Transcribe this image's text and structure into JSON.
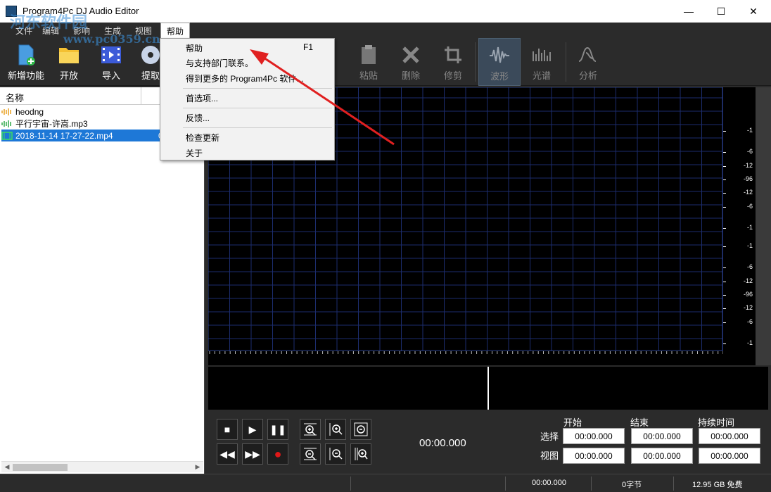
{
  "window": {
    "title": "Program4Pc DJ Audio Editor",
    "watermark": "河东软件园",
    "watermark_url": "www.pc0359.cn",
    "minimize": "—",
    "maximize": "☐",
    "close": "✕"
  },
  "menubar": {
    "items": [
      "文件",
      "编辑",
      "影响",
      "生成",
      "视图",
      "帮助"
    ],
    "active": "帮助"
  },
  "toolbar": {
    "new": "新增功能",
    "open": "开放",
    "import": "导入",
    "extract": "提取",
    "paste": "粘贴",
    "delete": "删除",
    "trim": "修剪",
    "waveform": "波形",
    "spectrum": "光谱",
    "analysis": "分析"
  },
  "file_panel": {
    "column_name": "名称",
    "files": [
      {
        "name": "heodng",
        "type": "audio"
      },
      {
        "name": "平行宇宙-许嵩.mp3",
        "type": "audio"
      },
      {
        "name": "2018-11-14 17-27-22.mp4",
        "type": "video",
        "extra": "0"
      }
    ]
  },
  "db_labels": [
    "-1",
    "-6",
    "-12",
    "-96",
    "-12",
    "-6",
    "-1",
    "-1",
    "-6",
    "-12",
    "-96",
    "-12",
    "-6",
    "-1"
  ],
  "help_menu": {
    "items": [
      {
        "label": "帮助",
        "shortcut": "F1"
      },
      {
        "label": "与支持部门联系。"
      },
      {
        "label": "得到更多的 Program4Pc 软件..."
      },
      {
        "label": "首选项..."
      },
      {
        "label": "反馈..."
      },
      {
        "label": "检查更新"
      },
      {
        "label": "关于"
      }
    ]
  },
  "transport": {
    "time": "00:00.000",
    "col_start": "开始",
    "col_end": "结束",
    "col_duration": "持续时间",
    "row_selection": "选择",
    "row_view": "视图",
    "sel_start": "00:00.000",
    "sel_end": "00:00.000",
    "sel_duration": "00:00.000",
    "view_start": "00:00.000",
    "view_end": "00:00.000",
    "view_duration": "00:00.000"
  },
  "status": {
    "time": "00:00.000",
    "bytes": "0字节",
    "free": "12.95 GB 免费"
  },
  "colors": {
    "accent_blue": "#1e78d7",
    "annotation_red": "#e02020",
    "grid_blue": "#1c2d6e"
  }
}
